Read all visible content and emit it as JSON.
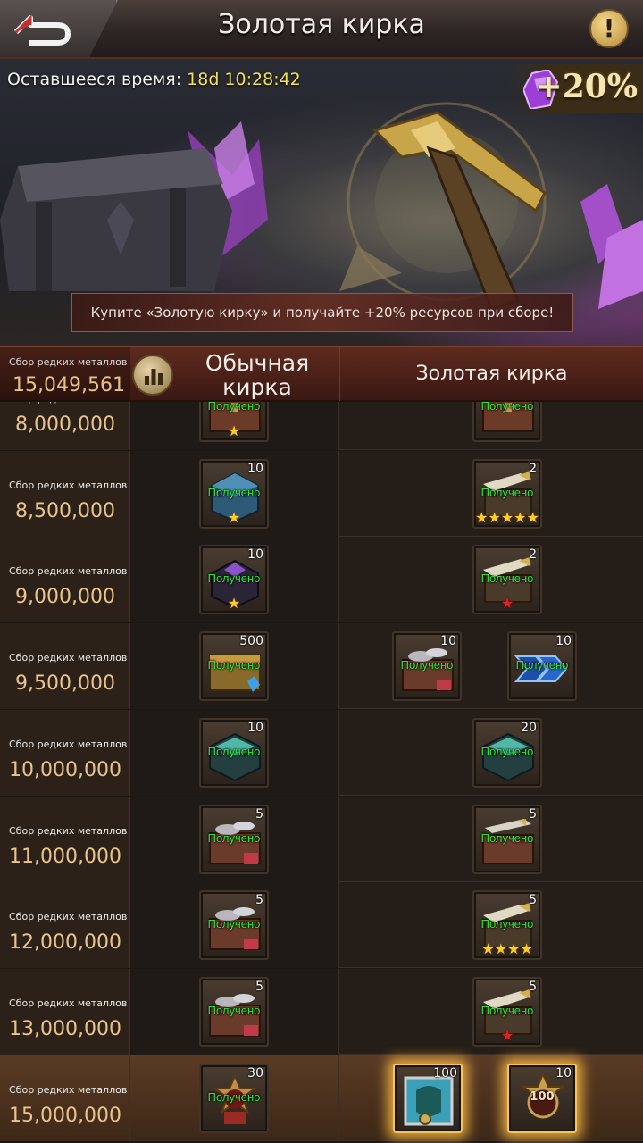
{
  "header": {
    "title": "Золотая кирка"
  },
  "banner": {
    "timer_label": "Оставшееся время:",
    "timer_value": "18d 10:28:42",
    "bonus": "+20%",
    "promo": "Купите «Золотую кирку» и получайте +20% ресурсов при сборе!"
  },
  "tabs": {
    "total_label": "Сбор редких металлов",
    "total_value": "15,049,561",
    "normal_line1": "Обычная",
    "normal_line2": "кирка",
    "gold": "Золотая кирка"
  },
  "received_label": "Получено",
  "rows": [
    {
      "label": "Сбор редких металлов",
      "value": "8,000,000",
      "normal": [
        {
          "icon": "chest-icon",
          "qty": "",
          "stars": "1-gold"
        }
      ],
      "gold": [
        {
          "icon": "chest-icon",
          "qty": "",
          "stars": ""
        }
      ]
    },
    {
      "label": "Сбор редких металлов",
      "value": "8,500,000",
      "normal": [
        {
          "icon": "blue-crate-icon",
          "qty": "10",
          "stars": "1-gold"
        }
      ],
      "gold": [
        {
          "icon": "missile-icon",
          "qty": "2",
          "stars": "5-gold"
        }
      ]
    },
    {
      "label": "Сбор редких металлов",
      "value": "9,000,000",
      "normal": [
        {
          "icon": "purple-crate-icon",
          "qty": "10",
          "stars": "1-gold"
        }
      ],
      "gold": [
        {
          "icon": "missile-icon",
          "qty": "2",
          "stars": "1-red"
        }
      ]
    },
    {
      "label": "Сбор редких металлов",
      "value": "9,500,000",
      "normal": [
        {
          "icon": "gold-chest-icon",
          "qty": "500",
          "stars": ""
        }
      ],
      "gold": [
        {
          "icon": "metal-chest-icon",
          "qty": "10",
          "stars": ""
        },
        {
          "icon": "speed-arrows-icon",
          "qty": "10",
          "stars": ""
        }
      ]
    },
    {
      "label": "Сбор редких металлов",
      "value": "10,000,000",
      "normal": [
        {
          "icon": "teal-crate-icon",
          "qty": "10",
          "stars": ""
        }
      ],
      "gold": [
        {
          "icon": "teal-crate-icon",
          "qty": "20",
          "stars": ""
        }
      ]
    },
    {
      "label": "Сбор редких металлов",
      "value": "11,000,000",
      "normal": [
        {
          "icon": "metal-chest-icon",
          "qty": "5",
          "stars": ""
        }
      ],
      "gold": [
        {
          "icon": "missile-chest-icon",
          "qty": "5",
          "stars": ""
        }
      ]
    },
    {
      "label": "Сбор редких металлов",
      "value": "12,000,000",
      "normal": [
        {
          "icon": "metal-chest-icon",
          "qty": "5",
          "stars": ""
        }
      ],
      "gold": [
        {
          "icon": "missile-icon",
          "qty": "5",
          "stars": "4-gold"
        }
      ]
    },
    {
      "label": "Сбор редких металлов",
      "value": "13,000,000",
      "normal": [
        {
          "icon": "metal-chest-icon",
          "qty": "5",
          "stars": ""
        }
      ],
      "gold": [
        {
          "icon": "missile-icon",
          "qty": "5",
          "stars": "1-red"
        }
      ]
    },
    {
      "label": "Сбор редких металлов",
      "value": "15,000,000",
      "normal": [
        {
          "icon": "medal-icon",
          "qty": "30",
          "stars": ""
        }
      ],
      "gold": [
        {
          "icon": "armor-icon",
          "qty": "100",
          "stars": ""
        },
        {
          "icon": "medal-100-icon",
          "qty": "10",
          "stars": "",
          "badge": "100"
        }
      ]
    }
  ],
  "colors": {
    "accent_gold": "#e9c48c",
    "received_green": "#2ee63a",
    "timer_yellow": "#f4e25a"
  }
}
